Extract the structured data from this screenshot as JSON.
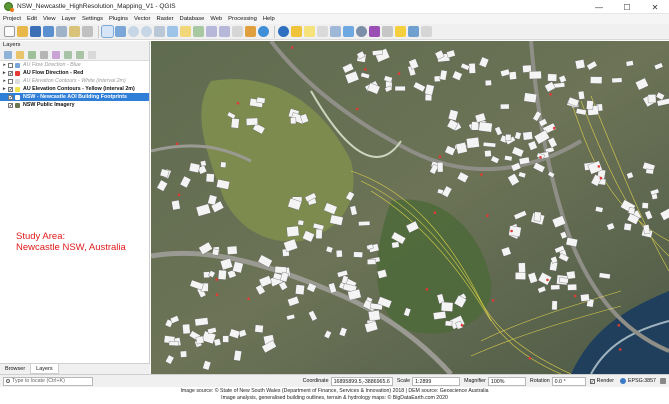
{
  "window": {
    "title": "NSW_Newcastle_HighResolution_Mapping_V1 - QGIS",
    "minimize": "—",
    "maximize": "☐",
    "close": "✕"
  },
  "menu": [
    "Project",
    "Edit",
    "View",
    "Layer",
    "Settings",
    "Plugins",
    "Vector",
    "Raster",
    "Database",
    "Web",
    "Processing",
    "Help"
  ],
  "layers_panel": {
    "title": "Layers",
    "layers": [
      {
        "label": "AU Flow Direction - Blue",
        "checked": false,
        "style": "dim"
      },
      {
        "label": "AU Flow Direction - Red",
        "checked": true,
        "style": "bold"
      },
      {
        "label": "AU Elevation Contours - White (interval 2m)",
        "checked": false,
        "style": "dim"
      },
      {
        "label": "AU Elevation Contours - Yellow (interval 2m)",
        "checked": true,
        "style": "bold"
      },
      {
        "label": "NSW - Newcastle AOI Building Footprints",
        "checked": true,
        "style": "selected"
      },
      {
        "label": "NSW Public Imagery",
        "checked": true,
        "style": "bold"
      }
    ]
  },
  "annotation": {
    "line1": "Study Area:",
    "line2": "Newcastle NSW, Australia"
  },
  "panel_tabs": [
    "Browser",
    "Layers"
  ],
  "statusbar": {
    "locator_placeholder": "Type to locate (Ctrl+K)",
    "coordinate_label": "Coordinate",
    "coordinate_value": "16895899.5,-3886965.6",
    "scale_label": "Scale",
    "scale_value": "1:2899",
    "magnifier_label": "Magnifier",
    "magnifier_value": "100%",
    "rotation_label": "Rotation",
    "rotation_value": "0.0 °",
    "render_label": "Render",
    "epsg": "EPSG:3857"
  },
  "caption": {
    "line1": "Image source: © State of New South Wales (Department of Finance, Services & Innovation) 2018 | DEM source: Geoscience Australia",
    "line2": "Image analysis, generalised building outlines, terrain & hydrology maps: © BigDataEarth.com 2020"
  },
  "colors": {
    "selection": "#2f7ed8",
    "annotation": "#e01b1b",
    "contour": "#f2e14b",
    "flow": "#e53935",
    "building": "#f4f4f4"
  }
}
